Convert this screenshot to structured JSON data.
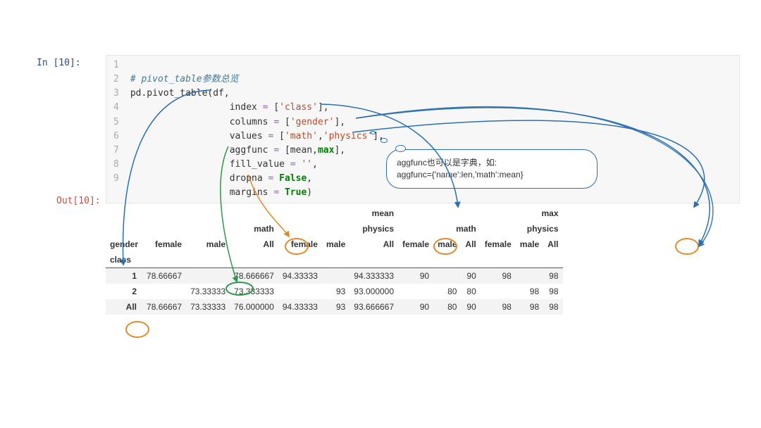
{
  "prompt": {
    "in": "In  [10]:",
    "out": "Out[10]:"
  },
  "code": {
    "lines": [
      "1",
      "2",
      "3",
      "4",
      "5",
      "6",
      "7",
      "8",
      "9"
    ],
    "l1_comment": "# pivot_table参数总览",
    "l2_a": "pd.pivot_table(df,",
    "l3_a": "                  index ",
    "l3_b": "=",
    "l3_c": " [",
    "l3_s1": "'class'",
    "l3_d": "],",
    "l4_a": "                  columns ",
    "l4_b": "=",
    "l4_c": " [",
    "l4_s1": "'gender'",
    "l4_d": "],",
    "l5_a": "                  values ",
    "l5_b": "=",
    "l5_c": " [",
    "l5_s1": "'math'",
    "l5_m": ",",
    "l5_s2": "'physics'",
    "l5_d": "],",
    "l6_a": "                  aggfunc ",
    "l6_b": "=",
    "l6_c": " [mean,",
    "l6_kw": "max",
    "l6_d": "],",
    "l7_a": "                  fill_value ",
    "l7_b": "=",
    "l7_c": " ",
    "l7_s1": "''",
    "l7_d": ",",
    "l8_a": "                  dropna ",
    "l8_b": "=",
    "l8_c": " ",
    "l8_kw": "False",
    "l8_d": ",",
    "l9_a": "                  margins ",
    "l9_b": "=",
    "l9_c": " ",
    "l9_kw": "True",
    "l9_d": ")"
  },
  "cloud": {
    "line1": "aggfunc也可以是字典，如:",
    "line2": "aggfunc={'name':len,'math':mean}"
  },
  "chart_data": {
    "type": "table",
    "super_cols_l0": [
      "mean",
      "max"
    ],
    "super_cols_l1": [
      "math",
      "physics",
      "math",
      "physics"
    ],
    "col_leaves": [
      "female",
      "male",
      "All",
      "female",
      "male",
      "All",
      "female",
      "male",
      "All",
      "female",
      "male",
      "All"
    ],
    "index_name": "class",
    "columns_name": "gender",
    "rows": [
      {
        "label": "1",
        "cells": [
          "78.66667",
          "",
          "78.666667",
          "94.33333",
          "",
          "94.333333",
          "90",
          "",
          "90",
          "98",
          "",
          "98"
        ]
      },
      {
        "label": "2",
        "cells": [
          "",
          "73.33333",
          "73.333333",
          "",
          "93",
          "93.000000",
          "",
          "80",
          "80",
          "",
          "98",
          "98"
        ]
      },
      {
        "label": "All",
        "cells": [
          "78.66667",
          "73.33333",
          "76.000000",
          "94.33333",
          "93",
          "93.666667",
          "90",
          "80",
          "90",
          "98",
          "98",
          "98"
        ]
      }
    ]
  }
}
